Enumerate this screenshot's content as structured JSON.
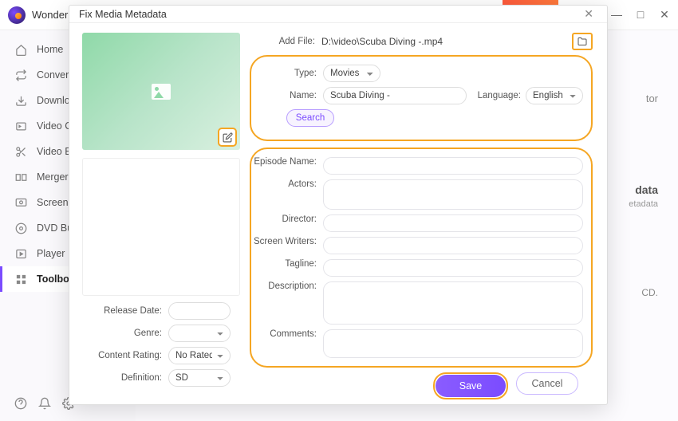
{
  "app": {
    "name": "Wonder"
  },
  "window_controls": {
    "min": "—",
    "max": "□",
    "close": "✕"
  },
  "sidebar": {
    "items": [
      {
        "label": "Home"
      },
      {
        "label": "Converter"
      },
      {
        "label": "Downloader"
      },
      {
        "label": "Video Compressor"
      },
      {
        "label": "Video Editor"
      },
      {
        "label": "Merger"
      },
      {
        "label": "Screen Recorder"
      },
      {
        "label": "DVD Burner"
      },
      {
        "label": "Player"
      },
      {
        "label": "Toolbox"
      }
    ]
  },
  "background_hints": {
    "a": "tor",
    "b": "data",
    "c": "etadata",
    "d": "CD."
  },
  "modal": {
    "title": "Fix Media Metadata",
    "add_file_label": "Add File:",
    "file_path": "D:\\video\\Scuba Diving -.mp4",
    "type_label": "Type:",
    "type_value": "Movies",
    "name_label": "Name:",
    "name_value": "Scuba Diving -",
    "language_label": "Language:",
    "language_value": "English",
    "search_label": "Search",
    "episode_label": "Episode Name:",
    "actors_label": "Actors:",
    "director_label": "Director:",
    "writers_label": "Screen Writers:",
    "tagline_label": "Tagline:",
    "description_label": "Description:",
    "comments_label": "Comments:",
    "left": {
      "release_date_label": "Release Date:",
      "genre_label": "Genre:",
      "content_rating_label": "Content Rating:",
      "content_rating_value": "No Rated",
      "definition_label": "Definition:",
      "definition_value": "SD"
    },
    "footer": {
      "save": "Save",
      "cancel": "Cancel"
    }
  }
}
